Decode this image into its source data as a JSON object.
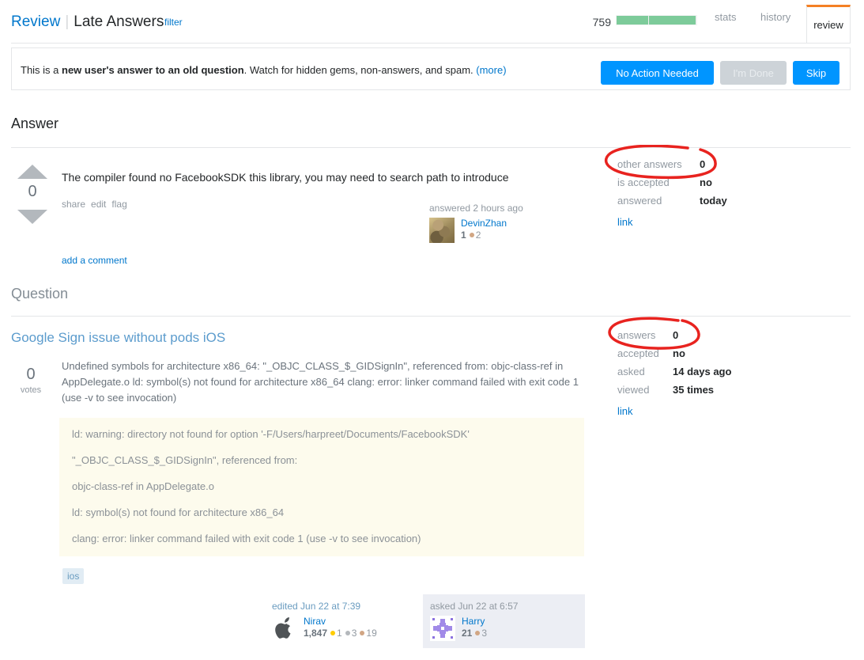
{
  "header": {
    "review_label": "Review",
    "separator": "|",
    "queue_name": "Late Answers",
    "filter_label": "filter",
    "count": "759",
    "progress_percent": 97,
    "tabs": [
      {
        "label": "stats",
        "active": false
      },
      {
        "label": "history",
        "active": false
      },
      {
        "label": "review",
        "active": true
      }
    ],
    "accent_color": "#f48024",
    "progress_color": "#7dcb9a"
  },
  "notice": {
    "text_before": "This is a ",
    "text_bold": "new user's answer to an old question",
    "text_after": ". Watch for hidden gems, non-answers, and spam. ",
    "more_label": "(more)",
    "buttons": {
      "no_action": "No Action Needed",
      "im_done": "I'm Done",
      "skip": "Skip"
    },
    "primary_color": "#0095ff",
    "disabled_color": "#cdd3d8"
  },
  "answer_section": {
    "heading": "Answer",
    "score": "0",
    "body": "The compiler found no FacebookSDK this library, you may need to search path to introduce",
    "menu": [
      "share",
      "edit",
      "flag"
    ],
    "add_comment": "add a comment",
    "user_card": {
      "action": "answered 2 hours ago",
      "name": "DevinZhan",
      "reputation": "1",
      "badges": [
        {
          "type": "bronze",
          "count": "2",
          "color": "#d1a684"
        }
      ]
    },
    "stats": {
      "rows": [
        {
          "key": "other answers",
          "value": "0"
        },
        {
          "key": "is accepted",
          "value": "no"
        },
        {
          "key": "answered",
          "value": "today"
        }
      ],
      "link_label": "link"
    }
  },
  "question_section": {
    "heading": "Question",
    "title": "Google Sign issue without pods iOS",
    "score": "0",
    "votes_label": "votes",
    "body": "Undefined symbols for architecture x86_64: \"_OBJC_CLASS_$_GIDSignIn\", referenced from: objc-class-ref in AppDelegate.o ld: symbol(s) not found for architecture x86_64 clang: error: linker command failed with exit code 1 (use -v to see invocation)",
    "quote_lines": [
      "ld: warning: directory not found for option '-F/Users/harpreet/Documents/FacebookSDK'",
      "\"_OBJC_CLASS_$_GIDSignIn\", referenced from:",
      "objc-class-ref in AppDelegate.o",
      "ld: symbol(s) not found for architecture x86_64",
      "clang: error: linker command failed with exit code 1 (use -v to see invocation)"
    ],
    "tags": [
      "ios"
    ],
    "stats": {
      "rows": [
        {
          "key": "answers",
          "value": "0"
        },
        {
          "key": "accepted",
          "value": "no"
        },
        {
          "key": "asked",
          "value": "14 days ago"
        },
        {
          "key": "viewed",
          "value": "35 times"
        }
      ],
      "link_label": "link"
    },
    "editor_card": {
      "action": "edited Jun 22 at 7:39",
      "name": "Nirav",
      "reputation": "1,847",
      "badges": [
        {
          "type": "gold",
          "count": "1",
          "color": "#ffcc01"
        },
        {
          "type": "silver",
          "count": "3",
          "color": "#b4b8bc"
        },
        {
          "type": "bronze",
          "count": "19",
          "color": "#d1a684"
        }
      ]
    },
    "owner_card": {
      "action": "asked Jun 22 at 6:57",
      "name": "Harry",
      "reputation": "21",
      "badges": [
        {
          "type": "bronze",
          "count": "3",
          "color": "#d1a684"
        }
      ]
    }
  },
  "annotations": {
    "color": "#e8231f",
    "shapes": [
      {
        "name": "circle-other-answers",
        "target": "other answers 0"
      },
      {
        "name": "circle-answers",
        "target": "answers 0"
      }
    ]
  }
}
